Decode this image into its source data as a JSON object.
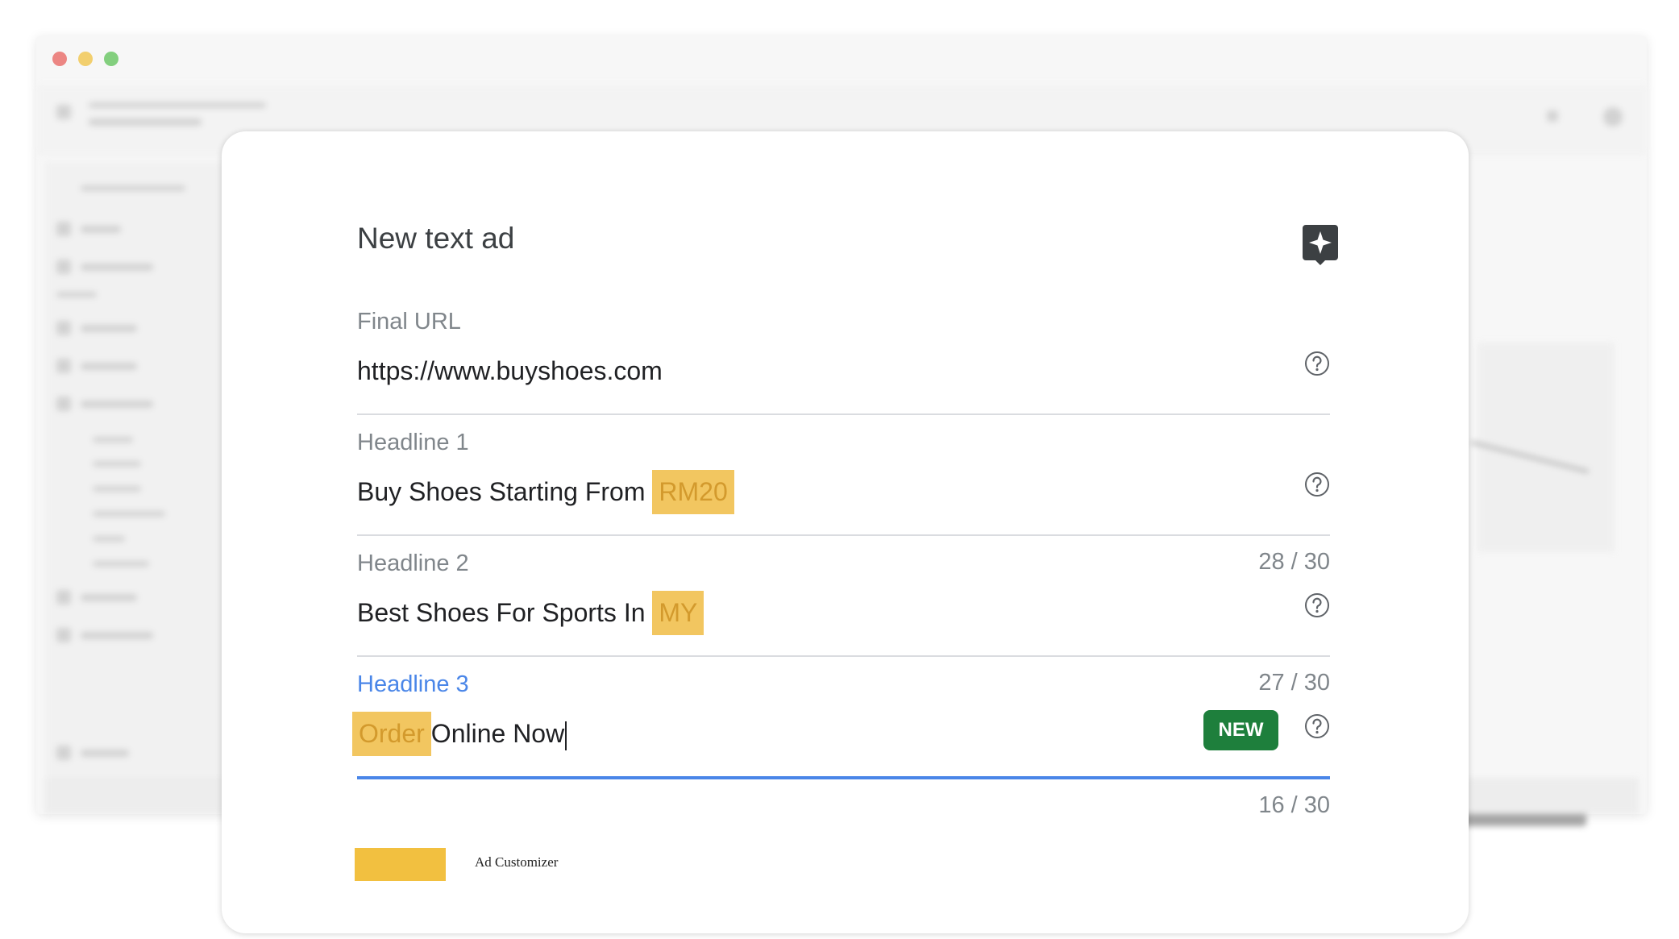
{
  "background": {
    "window_controls": [
      "close",
      "minimize",
      "maximize"
    ]
  },
  "modal": {
    "title": "New text ad",
    "action_icon": "sparkle-icon",
    "fields": {
      "final_url": {
        "label": "Final URL",
        "value": "https://www.buyshoes.com"
      },
      "headline1": {
        "label": "Headline 1",
        "value_text": "Buy Shoes Starting From ",
        "customizer": "RM20",
        "counter": "28 / 30"
      },
      "headline2": {
        "label": "Headline 2",
        "value_text": "Best Shoes For Sports In ",
        "customizer": "MY",
        "counter": "27 / 30"
      },
      "headline3": {
        "label": "Headline 3",
        "customizer": "Order",
        "value_text": "Online Now",
        "badge": "NEW",
        "counter": "16 / 30"
      }
    },
    "legend": {
      "label": "Ad Customizer",
      "color": "#f2c040"
    }
  },
  "colors": {
    "accent": "#4a86e8",
    "badge": "#1e7f3c",
    "customizer_highlight": "#f2c660"
  }
}
